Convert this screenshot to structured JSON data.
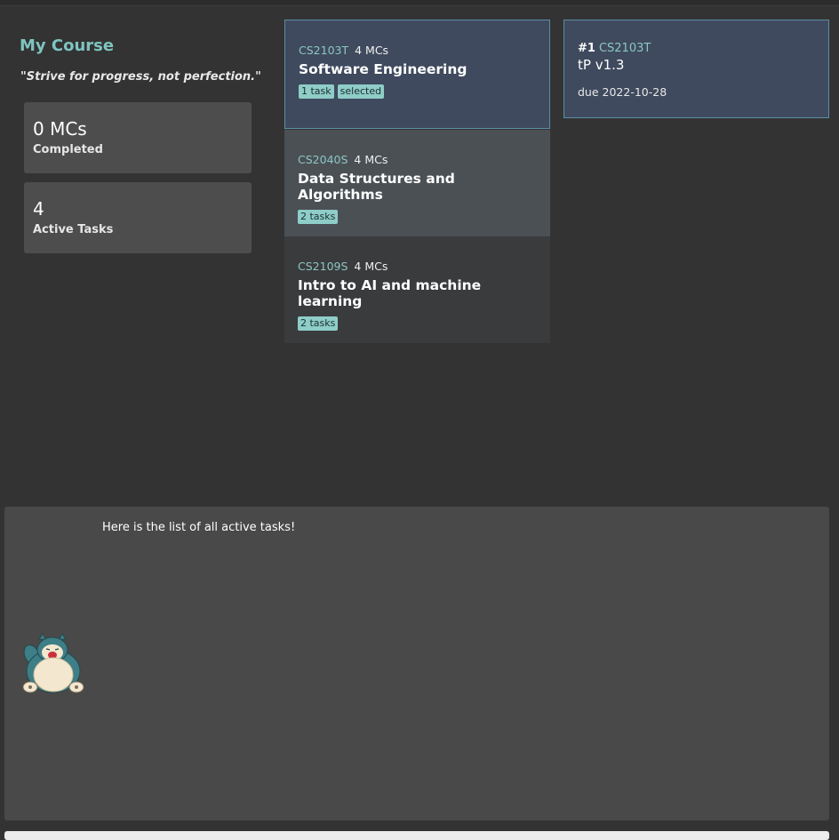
{
  "sidebar": {
    "title": "My Course",
    "quote": "\"Strive for progress, not perfection.\"",
    "stats": [
      {
        "value": "0 MCs",
        "label": "Completed"
      },
      {
        "value": "4",
        "label": "Active Tasks"
      }
    ]
  },
  "modules": [
    {
      "code": "CS2103T",
      "mcs": "4 MCs",
      "name": "Software Engineering",
      "tags": [
        "1 task",
        "selected"
      ]
    },
    {
      "code": "CS2040S",
      "mcs": "4 MCs",
      "name": "Data Structures and Algorithms",
      "tags": [
        "2 tasks"
      ]
    },
    {
      "code": "CS2109S",
      "mcs": "4 MCs",
      "name": "Intro to AI and machine learning",
      "tags": [
        "2 tasks"
      ]
    }
  ],
  "tasks": [
    {
      "index": "#1",
      "module": "CS2103T",
      "name": "tP v1.3",
      "due": "due 2022-10-28"
    }
  ],
  "result": {
    "message": "Here is the list of all active tasks!"
  },
  "icons": {
    "mascot": "snorlax-mascot-icon"
  },
  "colors": {
    "accent": "#7fc4c0",
    "tag": "#8ecdc8",
    "selected_bg": "#3f4a5e",
    "background": "#333333"
  }
}
